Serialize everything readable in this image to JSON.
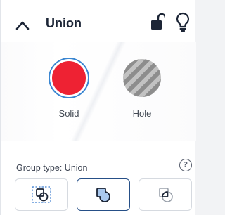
{
  "header": {
    "title": "Union"
  },
  "shapes": {
    "solid_label": "Solid",
    "hole_label": "Hole"
  },
  "group": {
    "label": "Group type: Union",
    "help_glyph": "?",
    "selected": "union"
  },
  "colors": {
    "solid": "#ee2233",
    "selection_ring": "#3a86d1",
    "active_button_border": "#264f87",
    "accent_fill": "#a9c8ee"
  },
  "icons": [
    "chevron-up-icon",
    "unlock-icon",
    "lightbulb-icon",
    "help-icon",
    "group-shapes-icon",
    "union-icon",
    "intersect-icon"
  ]
}
